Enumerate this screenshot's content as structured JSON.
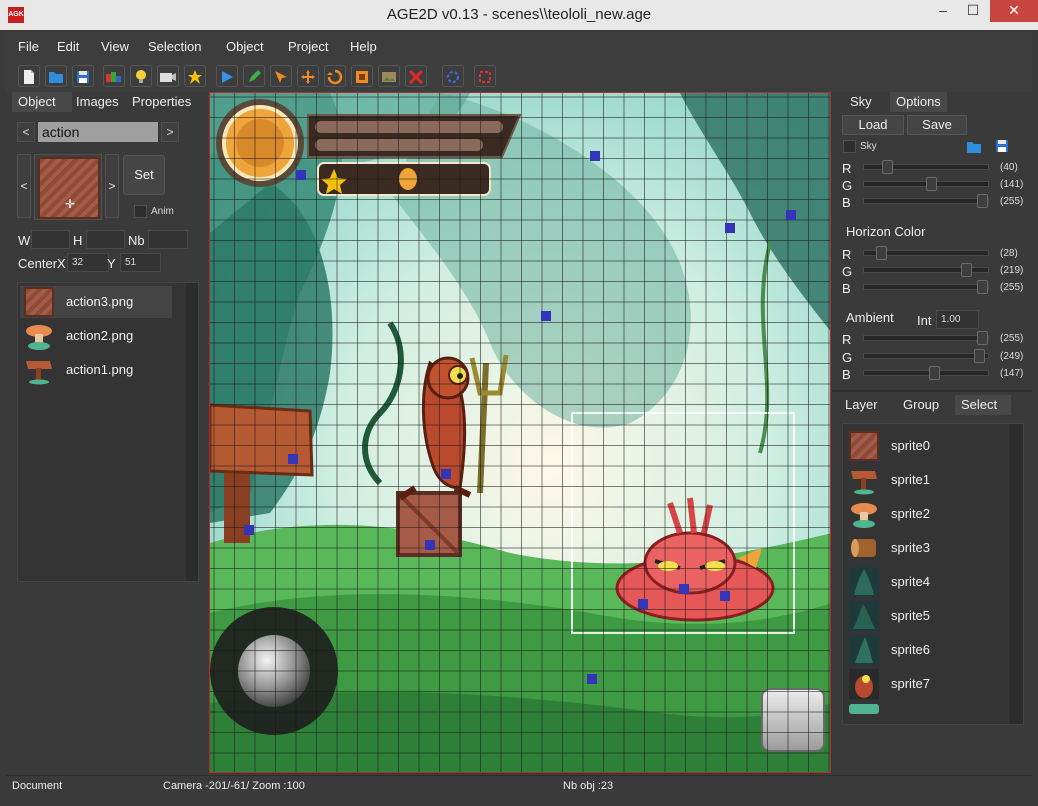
{
  "window": {
    "app_icon_text": "AGK",
    "title": "AGE2D v0.13 - scenes\\\\teololi_new.age",
    "minimize": "‒",
    "maximize": "☐",
    "close": "✕"
  },
  "menu": [
    "File",
    "Edit",
    "View",
    "Selection",
    "Object",
    "Project",
    "Help"
  ],
  "toolbar": {
    "icons": [
      "new-file-icon",
      "open-folder-icon",
      "save-icon",
      "color-palette-icon",
      "light-bulb-icon",
      "camera-icon",
      "star-icon",
      "play-icon",
      "pencil-icon",
      "move-arrow-icon",
      "move-cross-icon",
      "rotate-icon",
      "scale-icon",
      "image-icon",
      "delete-icon",
      "target-icon",
      "snap-icon"
    ]
  },
  "left_panel": {
    "tabs": [
      "Object",
      "Images",
      "Properties"
    ],
    "active_tab": "Object",
    "prev": "<",
    "next": ">",
    "animation_name": "action",
    "set_button": "Set",
    "anim_label": "Anim",
    "w_label": "W",
    "h_label": "H",
    "nb_label": "Nb",
    "centerx_label": "CenterX",
    "centerx_value": "32",
    "y_label": "Y",
    "y_value": "51",
    "images": [
      {
        "name": "action3.png",
        "icon": "crate-icon"
      },
      {
        "name": "action2.png",
        "icon": "mushroom-icon"
      },
      {
        "name": "action1.png",
        "icon": "signpost-icon"
      }
    ]
  },
  "right_panel": {
    "tabs": [
      "Sky",
      "Options"
    ],
    "active_tab": "Options",
    "load_button": "Load",
    "save_button": "Save",
    "sky_label": "Sky",
    "sky_color": {
      "r": {
        "label": "R",
        "value": "(40)",
        "level": 40
      },
      "g": {
        "label": "G",
        "value": "(141)",
        "level": 141
      },
      "b": {
        "label": "B",
        "value": "(255)",
        "level": 255
      }
    },
    "horizon_label": "Horizon Color",
    "horizon_color": {
      "r": {
        "label": "R",
        "value": "(28)",
        "level": 28
      },
      "g": {
        "label": "G",
        "value": "(219)",
        "level": 219
      },
      "b": {
        "label": "B",
        "value": "(255)",
        "level": 255
      }
    },
    "ambient_label": "Ambient",
    "int_label": "Int",
    "int_value": "1.00",
    "ambient_color": {
      "r": {
        "label": "R",
        "value": "(255)",
        "level": 255
      },
      "g": {
        "label": "G",
        "value": "(249)",
        "level": 249
      },
      "b": {
        "label": "B",
        "value": "(147)",
        "level": 147
      }
    },
    "layer_tabs": [
      "Layer",
      "Group",
      "Select"
    ],
    "active_layer_tab": "Select",
    "sprites": [
      "sprite0",
      "sprite1",
      "sprite2",
      "sprite3",
      "sprite4",
      "sprite5",
      "sprite6",
      "sprite7"
    ]
  },
  "status": {
    "mode": "Document",
    "camera": "Camera -201/-61/ Zoom :100",
    "objects": "Nb obj :23"
  },
  "colors": {
    "sky": "#8fd2c9",
    "selection_marker": "#3434b8",
    "accent": "#c7463f"
  }
}
